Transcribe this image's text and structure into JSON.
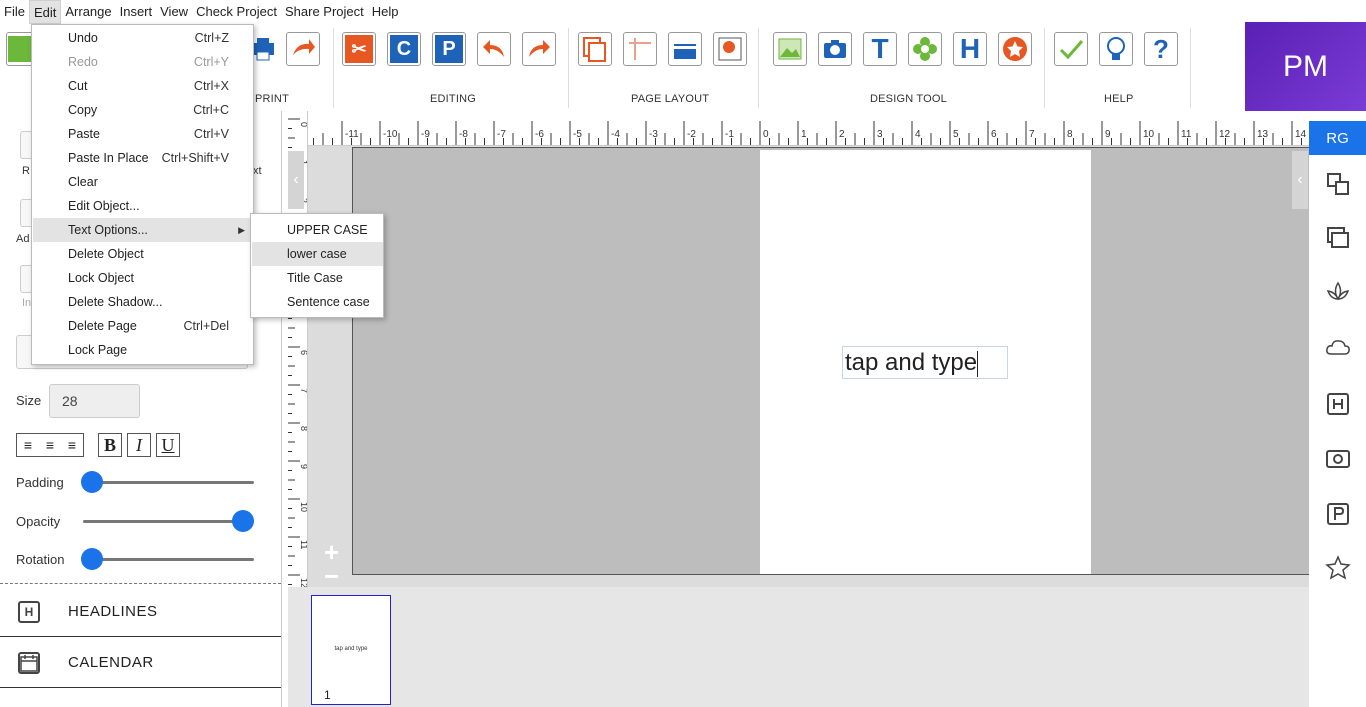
{
  "menubar": {
    "items": [
      "File",
      "Edit",
      "Arrange",
      "Insert",
      "View",
      "Check Project",
      "Share Project",
      "Help"
    ]
  },
  "toolbar": {
    "groups": {
      "print": "PRINT",
      "editing": "EDITING",
      "page_layout": "PAGE LAYOUT",
      "design_tool": "DESIGN TOOL",
      "help": "HELP"
    },
    "buttons": {
      "copy_letter": "C",
      "paste_letter": "P",
      "undo_letter": "U",
      "redo_letter": "R",
      "text_letter": "T",
      "headline_letter": "H",
      "help_glyph": "?"
    }
  },
  "brand": {
    "initials": "PM"
  },
  "edit_menu": {
    "items": [
      {
        "label": "Undo",
        "shortcut": "Ctrl+Z",
        "disabled": false
      },
      {
        "label": "Redo",
        "shortcut": "Ctrl+Y",
        "disabled": true
      },
      {
        "label": "Cut",
        "shortcut": "Ctrl+X",
        "disabled": false
      },
      {
        "label": "Copy",
        "shortcut": "Ctrl+C",
        "disabled": false
      },
      {
        "label": "Paste",
        "shortcut": "Ctrl+V",
        "disabled": false
      },
      {
        "label": "Paste In Place",
        "shortcut": "Ctrl+Shift+V",
        "disabled": false
      },
      {
        "label": "Clear",
        "shortcut": "",
        "disabled": false
      },
      {
        "label": "Edit Object...",
        "shortcut": "",
        "disabled": false
      },
      {
        "label": "Text Options...",
        "shortcut": "",
        "disabled": false
      },
      {
        "label": "Delete Object",
        "shortcut": "",
        "disabled": false
      },
      {
        "label": "Lock Object",
        "shortcut": "",
        "disabled": false
      },
      {
        "label": "Delete Shadow...",
        "shortcut": "",
        "disabled": false
      },
      {
        "label": "Delete Page",
        "shortcut": "Ctrl+Del",
        "disabled": false
      },
      {
        "label": "Lock Page",
        "shortcut": "",
        "disabled": false
      }
    ]
  },
  "text_options_submenu": {
    "items": [
      "UPPER CASE",
      "lower case",
      "Title Case",
      "Sentence case"
    ]
  },
  "left_panel": {
    "size_label": "Size",
    "size_value": "28",
    "bold": "B",
    "italic": "I",
    "underline": "U",
    "padding_label": "Padding",
    "opacity_label": "Opacity",
    "rotation_label": "Rotation",
    "padding_value": 0,
    "opacity_value": 1,
    "rotation_value": 0,
    "partial_labels": {
      "r": "R",
      "ad": "Ad",
      "in": "In",
      "xt": "xt"
    },
    "sections": [
      {
        "icon": "H",
        "label": "HEADLINES"
      },
      {
        "icon": "cal",
        "label": "CALENDAR"
      }
    ]
  },
  "ruler": {
    "top_labels": [
      "-11",
      "-10",
      "-9",
      "-8",
      "-7",
      "-6",
      "-5",
      "-4",
      "-3",
      "-2",
      "-1",
      "0",
      "1",
      "2",
      "3",
      "4",
      "5",
      "6",
      "7",
      "8",
      "9",
      "10",
      "11",
      "12",
      "13",
      "14"
    ],
    "left_labels": [
      "0",
      "1",
      "2",
      "3",
      "4",
      "5",
      "6",
      "7",
      "8",
      "9",
      "10",
      "11",
      "12"
    ]
  },
  "canvas": {
    "text": "tap and type",
    "zoom_in": "+",
    "zoom_out": "−"
  },
  "thumbnails": [
    {
      "text": "tap and type",
      "number": "1"
    }
  ],
  "right_rail": {
    "badge": "RG",
    "icons": [
      "shapes-icon",
      "layouts-icon",
      "lotus-icon",
      "cloud-com-icon",
      "headline-icon",
      "photo-icon",
      "p-icon",
      "star-icon"
    ]
  },
  "colors": {
    "accent_blue": "#1a73e8",
    "brand_purple": "#5a1fb4",
    "editing_red": "#e65722",
    "icon_blue": "#1e63b8",
    "green": "#6bb83a"
  }
}
